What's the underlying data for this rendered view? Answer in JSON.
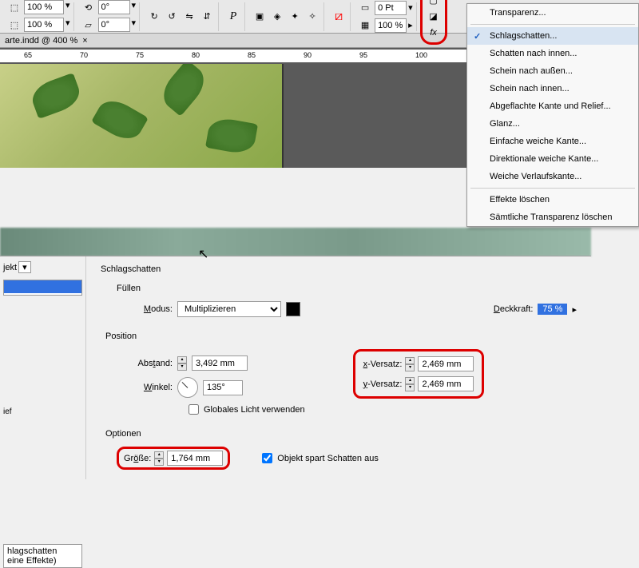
{
  "toolbar": {
    "zoom1": "100 %",
    "zoom2": "100 %",
    "angle1": "0°",
    "angle2": "0°",
    "stroke": "0 Pt"
  },
  "doc_tab": "arte.indd @ 400 %",
  "ruler": {
    "ticks": [
      "65",
      "70",
      "75",
      "80",
      "85",
      "90",
      "95",
      "100"
    ]
  },
  "menu": {
    "items": [
      "Transparenz...",
      "Schlagschatten...",
      "Schatten nach innen...",
      "Schein nach außen...",
      "Schein nach innen...",
      "Abgeflachte Kante und Relief...",
      "Glanz...",
      "Einfache weiche Kante...",
      "Direktionale weiche Kante...",
      "Weiche Verlaufskante...",
      "Effekte löschen",
      "Sämtliche Transparenz löschen"
    ]
  },
  "dialog": {
    "side_select": "jekt",
    "side_item": "ief",
    "side_item2a": "hlagschatten",
    "side_item2b": "eine Effekte)",
    "title": "Schlagschatten",
    "fill_section": "Füllen",
    "mode_label": "Modus:",
    "mode_value": "Multiplizieren",
    "opacity_label": "Deckkraft:",
    "opacity_value": "75 %",
    "position_section": "Position",
    "distance_label": "Abstand:",
    "distance_value": "3,492 mm",
    "angle_label": "Winkel:",
    "angle_value": "135°",
    "global_light": "Globales Licht verwenden",
    "xoffset_label": "x-Versatz:",
    "xoffset_value": "2,469 mm",
    "yoffset_label": "y-Versatz:",
    "yoffset_value": "2,469 mm",
    "options_section": "Optionen",
    "size_label": "Größe:",
    "size_value": "1,764 mm",
    "knockout": "Objekt spart Schatten aus"
  }
}
